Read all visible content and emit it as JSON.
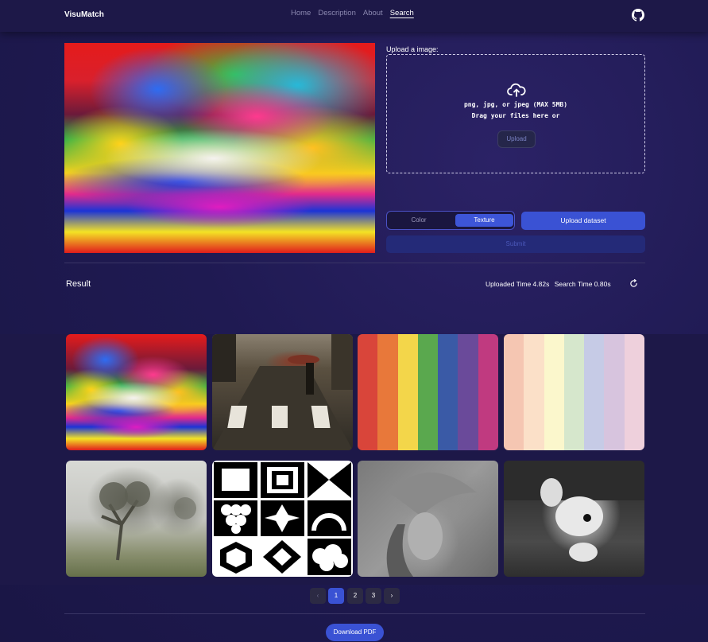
{
  "nav": {
    "brand": "VisuMatch",
    "links": [
      "Home",
      "Description",
      "About",
      "Search"
    ],
    "active": "Search",
    "github_icon": "github-icon"
  },
  "upload": {
    "label": "Upload a image:",
    "icon": "cloud-upload-icon",
    "formats": "png, jpg, or jpeg (MAX 5MB)",
    "hint": "Drag your files here or",
    "button": "Upload"
  },
  "mode": {
    "color": "Color",
    "texture": "Texture",
    "selected": "Texture"
  },
  "dataset_button": "Upload dataset",
  "submit_button": "Submit",
  "result": {
    "title": "Result",
    "uploaded_time": "Uploaded Time 4.82s",
    "search_time": "Search Time 0.80s",
    "refresh_icon": "refresh-icon"
  },
  "results_grid": [
    {
      "kind": "color-burst"
    },
    {
      "kind": "rainy-street"
    },
    {
      "kind": "rainbow-stripes",
      "colors": [
        "#d9453a",
        "#e8783a",
        "#f3d64a",
        "#5aa84e",
        "#3a5aa6",
        "#6a4a9a",
        "#c03a80"
      ]
    },
    {
      "kind": "pastel-stripes",
      "colors": [
        "#f5c6b2",
        "#fbe0c8",
        "#fbf7cc",
        "#d6e7cc",
        "#c6cbe6",
        "#d7c4de",
        "#eed0dc"
      ]
    },
    {
      "kind": "foggy-tree"
    },
    {
      "kind": "bw-patterns"
    },
    {
      "kind": "grayscale-portrait"
    },
    {
      "kind": "grayscale-dog"
    }
  ],
  "pagination": {
    "prev": "‹",
    "pages": [
      "1",
      "2",
      "3"
    ],
    "current": "1",
    "next": "›"
  },
  "download_button": "Download PDF",
  "colors": {
    "accent": "#3a52d4",
    "background": "#1f1a52",
    "nav": "#1d1848"
  }
}
